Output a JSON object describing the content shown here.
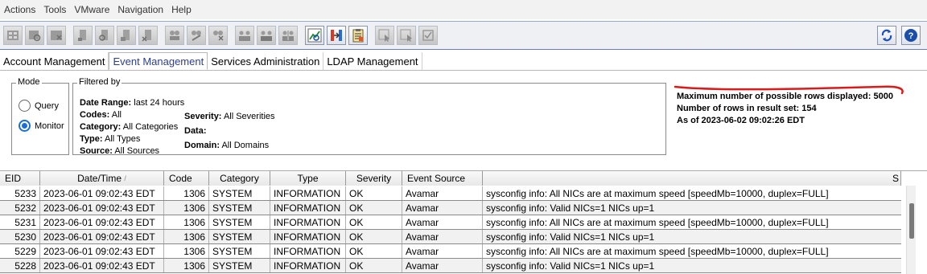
{
  "menu": [
    "Actions",
    "Tools",
    "VMware",
    "Navigation",
    "Help"
  ],
  "toolbar": {
    "buttons": [
      {
        "icon": "grid-add-icon",
        "enabled": false
      },
      {
        "icon": "grid-search-icon",
        "enabled": false
      },
      {
        "icon": "grid-delete-icon",
        "enabled": false
      },
      {
        "icon": "client-add-icon",
        "enabled": false
      },
      {
        "icon": "client-search-icon",
        "enabled": false
      },
      {
        "icon": "client-edit-icon",
        "enabled": false
      },
      {
        "icon": "client-remove-icon",
        "enabled": false
      },
      {
        "icon": "group-add-icon",
        "enabled": false
      },
      {
        "icon": "group-edit-icon",
        "enabled": false
      },
      {
        "icon": "group-remove-icon",
        "enabled": false
      },
      {
        "icon": "users-icon",
        "enabled": false
      },
      {
        "icon": "users-edit-icon",
        "enabled": false
      },
      {
        "icon": "users-settings-icon",
        "enabled": false
      },
      {
        "icon": "chart-icon",
        "enabled": true
      },
      {
        "icon": "transfer-icon",
        "enabled": true
      },
      {
        "icon": "report-icon",
        "enabled": true
      },
      {
        "icon": "cursor-icon",
        "enabled": false
      },
      {
        "icon": "cursor-select-icon",
        "enabled": false
      },
      {
        "icon": "checkbox-icon",
        "enabled": false
      }
    ],
    "refresh_icon": "refresh-icon",
    "help_icon": "help-icon"
  },
  "tabs": [
    "Account Management",
    "Event Management",
    "Services Administration",
    "LDAP Management"
  ],
  "active_tab": 1,
  "mode": {
    "legend": "Mode",
    "options": [
      "Query",
      "Monitor"
    ],
    "selected": "Monitor"
  },
  "filter": {
    "legend": "Filtered by",
    "date_range_label": "Date Range:",
    "date_range": "last 24 hours",
    "codes_label": "Codes:",
    "codes": "All",
    "category_label": "Category:",
    "category": "All Categories",
    "type_label": "Type:",
    "type": "All Types",
    "source_label": "Source:",
    "source": "All Sources",
    "severity_label": "Severity:",
    "severity": "All Severities",
    "data_label": "Data:",
    "data": "",
    "domain_label": "Domain:",
    "domain": "All Domains"
  },
  "info": {
    "max_rows": "Maximum number of possible rows displayed: 5000",
    "result_rows": "Number of rows in result set: 154",
    "as_of": "As of 2023-06-02 09:02:26 EDT"
  },
  "table": {
    "headers": [
      "EID",
      "Date/Time",
      "Code",
      "Category",
      "Type",
      "Severity",
      "Event Source",
      "",
      "S"
    ],
    "sort_indicator": "/",
    "rows": [
      {
        "eid": "5233",
        "datetime": "2023-06-01 09:02:43 EDT",
        "code": "1306",
        "category": "SYSTEM",
        "type": "INFORMATION",
        "severity": "OK",
        "source": "Avamar",
        "summary": "sysconfig info: All NICs are at maximum speed [speedMb=10000, duplex=FULL]"
      },
      {
        "eid": "5232",
        "datetime": "2023-06-01 09:02:43 EDT",
        "code": "1306",
        "category": "SYSTEM",
        "type": "INFORMATION",
        "severity": "OK",
        "source": "Avamar",
        "summary": "sysconfig info: Valid NICs=1 NICs up=1"
      },
      {
        "eid": "5231",
        "datetime": "2023-06-01 09:02:43 EDT",
        "code": "1306",
        "category": "SYSTEM",
        "type": "INFORMATION",
        "severity": "OK",
        "source": "Avamar",
        "summary": "sysconfig info: All NICs are at maximum speed [speedMb=10000, duplex=FULL]"
      },
      {
        "eid": "5230",
        "datetime": "2023-06-01 09:02:43 EDT",
        "code": "1306",
        "category": "SYSTEM",
        "type": "INFORMATION",
        "severity": "OK",
        "source": "Avamar",
        "summary": "sysconfig info: Valid NICs=1 NICs up=1"
      },
      {
        "eid": "5229",
        "datetime": "2023-06-01 09:02:43 EDT",
        "code": "1306",
        "category": "SYSTEM",
        "type": "INFORMATION",
        "severity": "OK",
        "source": "Avamar",
        "summary": "sysconfig info: All NICs are at maximum speed [speedMb=10000, duplex=FULL]"
      },
      {
        "eid": "5228",
        "datetime": "2023-06-01 09:02:43 EDT",
        "code": "1306",
        "category": "SYSTEM",
        "type": "INFORMATION",
        "severity": "OK",
        "source": "Avamar",
        "summary": "sysconfig info: Valid NICs=1 NICs up=1"
      }
    ]
  },
  "colors": {
    "accent_blue": "#1a6ed8",
    "tab_active_text": "#2d3f8c",
    "annotation_red": "#d81b1b"
  }
}
